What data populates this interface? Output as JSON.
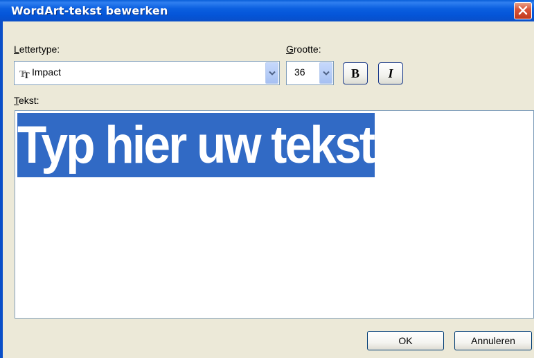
{
  "window": {
    "title": "WordArt-tekst bewerken",
    "close_icon": "close-icon"
  },
  "font": {
    "label": "Lettertype:",
    "label_accel": "L",
    "label_rest": "ettertype:",
    "selected": "Impact",
    "icon": "truetype-font-icon"
  },
  "size": {
    "label": "Grootte:",
    "label_accel": "G",
    "label_rest": "rootte:",
    "selected": "36"
  },
  "format": {
    "bold_label": "B",
    "italic_label": "I"
  },
  "text": {
    "label": "Tekst:",
    "label_accel": "T",
    "label_rest": "ekst:",
    "value": "Typ hier uw tekst"
  },
  "buttons": {
    "ok": "OK",
    "cancel": "Annuleren"
  },
  "colors": {
    "titlebar": "#0455d8",
    "selection": "#316ac5",
    "dialog_bg": "#ece9d8"
  }
}
